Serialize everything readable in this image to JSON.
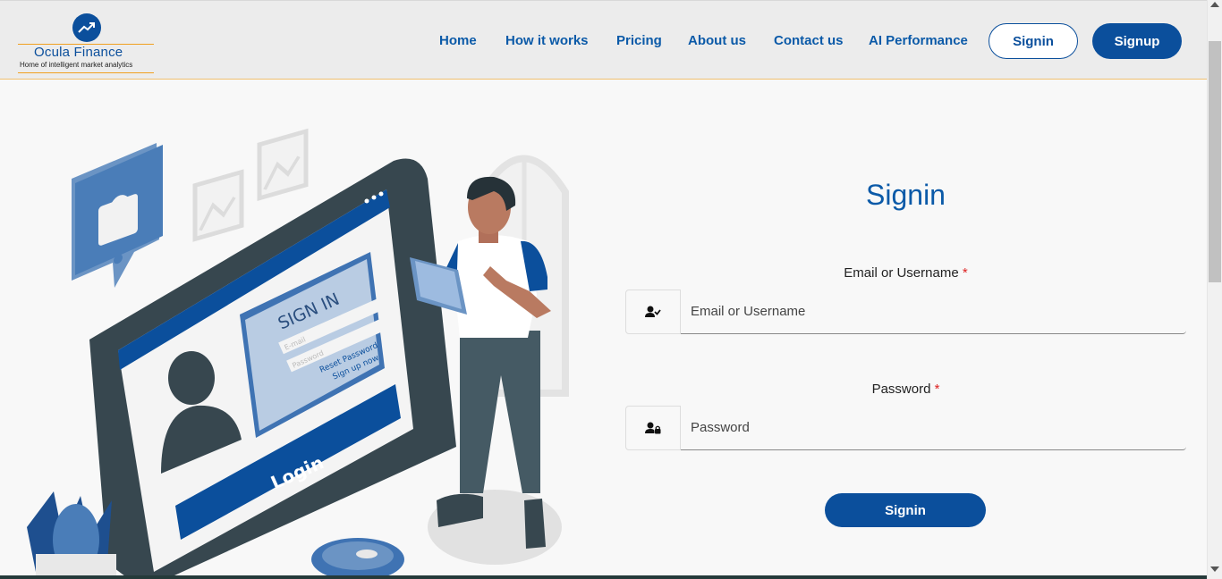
{
  "brand": {
    "name": "Ocula Finance",
    "tagline": "Home of intelligent market analytics",
    "color": "#0b4f9c"
  },
  "nav": {
    "links": [
      "Home",
      "How it works",
      "Pricing",
      "About us",
      "Contact us",
      "AI Performance"
    ],
    "signin_label": "Signin",
    "signup_label": "Signup"
  },
  "illustration": {
    "panel_title": "SIGN IN",
    "email_hint": "E-mail",
    "password_hint": "Password",
    "reset_link": "Reset Password",
    "signup_link": "Sign up now",
    "login_bar": "Login"
  },
  "form": {
    "title": "Signin",
    "email_label": "Email or Username",
    "email_placeholder": "Email or Username",
    "password_label": "Password",
    "password_placeholder": "Password",
    "required_mark": "*",
    "submit_label": "Signin"
  },
  "icons": {
    "brand": "trend-up-icon",
    "email": "user-check-icon",
    "password": "user-lock-icon"
  }
}
